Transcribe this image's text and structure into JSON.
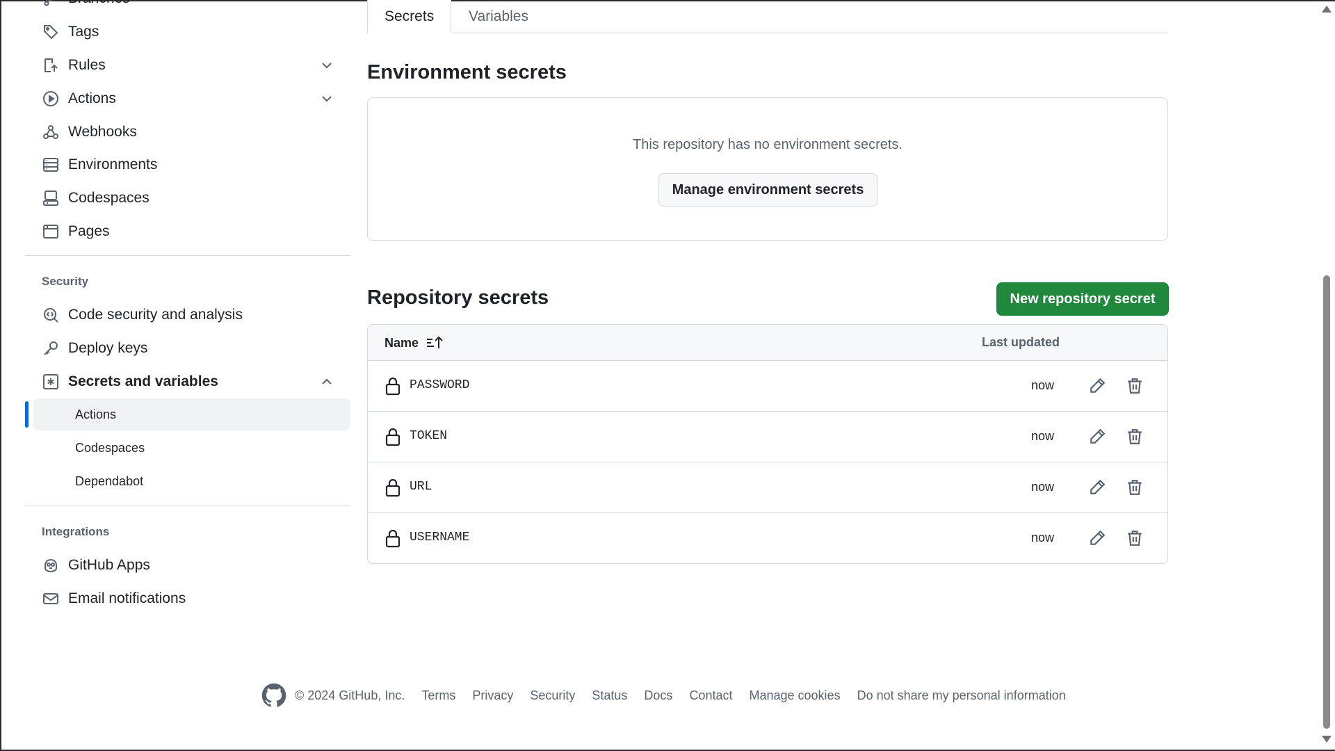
{
  "sidebar": {
    "items_top": [
      {
        "label": "Branches",
        "icon": "branch-icon"
      },
      {
        "label": "Tags",
        "icon": "tag-icon"
      },
      {
        "label": "Rules",
        "icon": "rules-icon"
      },
      {
        "label": "Actions",
        "icon": "play-icon"
      },
      {
        "label": "Webhooks",
        "icon": "webhook-icon"
      },
      {
        "label": "Environments",
        "icon": "server-icon"
      },
      {
        "label": "Codespaces",
        "icon": "codespaces-icon"
      },
      {
        "label": "Pages",
        "icon": "browser-icon"
      }
    ],
    "security_label": "Security",
    "security_items": [
      {
        "label": "Code security and analysis",
        "icon": "codescan-icon"
      },
      {
        "label": "Deploy keys",
        "icon": "key-icon"
      },
      {
        "label": "Secrets and variables",
        "icon": "asterisk-icon"
      }
    ],
    "sub_items": [
      {
        "label": "Actions",
        "active": true
      },
      {
        "label": "Codespaces"
      },
      {
        "label": "Dependabot"
      }
    ],
    "integrations_label": "Integrations",
    "integration_items": [
      {
        "label": "GitHub Apps",
        "icon": "copilot-icon"
      },
      {
        "label": "Email notifications",
        "icon": "mail-icon"
      }
    ]
  },
  "tabs": {
    "secrets": "Secrets",
    "variables": "Variables"
  },
  "environment": {
    "heading": "Environment secrets",
    "empty_text": "This repository has no environment secrets.",
    "manage_button": "Manage environment secrets"
  },
  "repository": {
    "heading": "Repository secrets",
    "new_button": "New repository secret",
    "col_name": "Name",
    "col_updated": "Last updated",
    "rows": [
      {
        "name": "PASSWORD",
        "updated": "now"
      },
      {
        "name": "TOKEN",
        "updated": "now"
      },
      {
        "name": "URL",
        "updated": "now"
      },
      {
        "name": "USERNAME",
        "updated": "now"
      }
    ]
  },
  "footer": {
    "copyright": "© 2024 GitHub, Inc.",
    "links": [
      "Terms",
      "Privacy",
      "Security",
      "Status",
      "Docs",
      "Contact",
      "Manage cookies",
      "Do not share my personal information"
    ]
  },
  "colors": {
    "primary_button": "#1f883d",
    "active_indicator": "#0969da"
  }
}
